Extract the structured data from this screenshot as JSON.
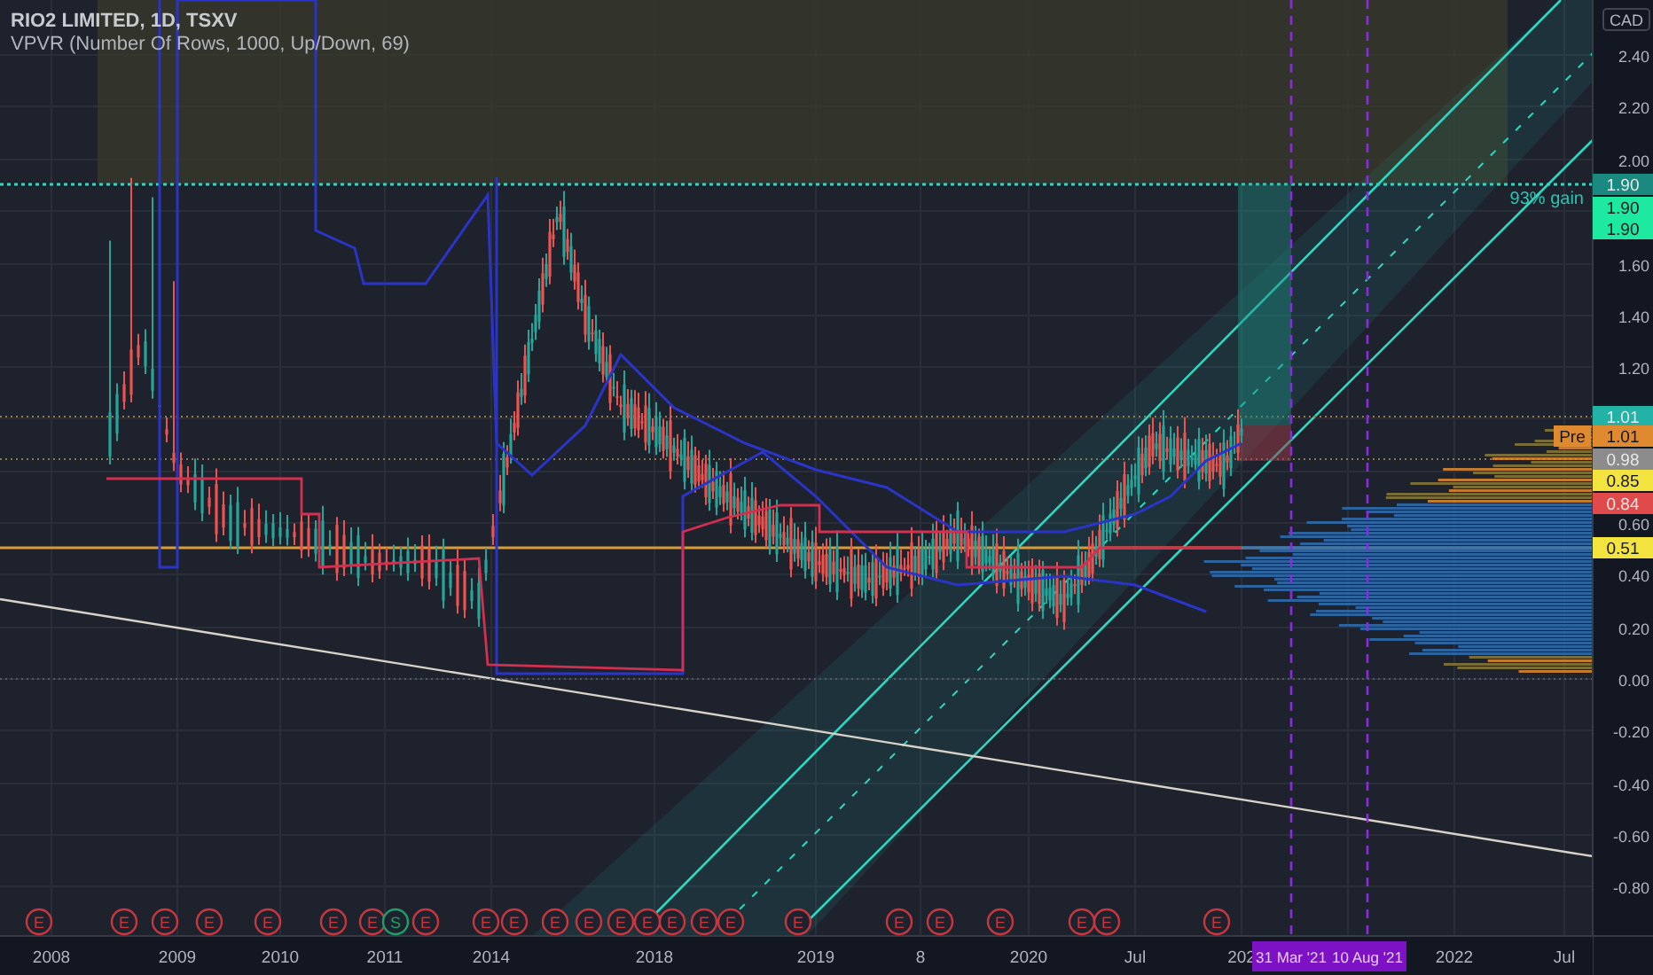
{
  "legend": {
    "title": "RIO2 LIMITED, 1D, TSXV",
    "indicator": "VPVR (Number Of Rows, 1000, Up/Down, 69)"
  },
  "price_axis": {
    "currency": "CAD",
    "labels": [
      "2.40",
      "2.20",
      "2.00",
      "1.60",
      "1.40",
      "1.20",
      "0.60",
      "0.40",
      "0.20",
      "0.00",
      "-0.20",
      "-0.40",
      "-0.60",
      "-0.80"
    ]
  },
  "price_tags": [
    {
      "text": "1.90",
      "color": "#1a8a80"
    },
    {
      "text": "1.90",
      "color": "#1de9a0"
    },
    {
      "text": "1.90",
      "color": "#1de9a0"
    },
    {
      "text": "1.01",
      "color": "#22b3a6"
    },
    {
      "text": "Pre",
      "color": "#df8a2f"
    },
    {
      "text": "1.01",
      "color": "#df8a2f"
    },
    {
      "text": "0.98",
      "color": "#8c8c8c"
    },
    {
      "text": "0.85",
      "color": "#f2e33e"
    },
    {
      "text": "0.84",
      "color": "#e04a4a"
    },
    {
      "text": "0.51",
      "color": "#f2e33e"
    }
  ],
  "gain_label": "93% gain",
  "time_axis": {
    "labels": [
      "2008",
      "2009",
      "2010",
      "2011",
      "2014",
      "2018",
      "2019",
      "8",
      "2020",
      "Jul",
      "202",
      "2022",
      "Jul"
    ]
  },
  "date_badges": [
    "31 Mar '21",
    "10 Aug '21"
  ],
  "events": [
    {
      "label": "E",
      "color": "#c8363f"
    },
    {
      "label": "E",
      "color": "#c8363f"
    },
    {
      "label": "E",
      "color": "#c8363f"
    },
    {
      "label": "E",
      "color": "#c8363f"
    },
    {
      "label": "E",
      "color": "#c8363f"
    },
    {
      "label": "E",
      "color": "#c8363f"
    },
    {
      "label": "E",
      "color": "#c8363f"
    },
    {
      "label": "S",
      "color": "#1f9e6a"
    },
    {
      "label": "E",
      "color": "#c8363f"
    },
    {
      "label": "E",
      "color": "#c8363f"
    },
    {
      "label": "E",
      "color": "#c8363f"
    },
    {
      "label": "E",
      "color": "#c8363f"
    },
    {
      "label": "E",
      "color": "#c8363f"
    },
    {
      "label": "E",
      "color": "#c8363f"
    },
    {
      "label": "E",
      "color": "#c8363f"
    },
    {
      "label": "E",
      "color": "#c8363f"
    },
    {
      "label": "E",
      "color": "#c8363f"
    },
    {
      "label": "E",
      "color": "#c8363f"
    },
    {
      "label": "E",
      "color": "#c8363f"
    },
    {
      "label": "E",
      "color": "#c8363f"
    },
    {
      "label": "E",
      "color": "#c8363f"
    },
    {
      "label": "E",
      "color": "#c8363f"
    },
    {
      "label": "E",
      "color": "#c8363f"
    },
    {
      "label": "E",
      "color": "#c8363f"
    },
    {
      "label": "E",
      "color": "#c8363f"
    }
  ]
}
